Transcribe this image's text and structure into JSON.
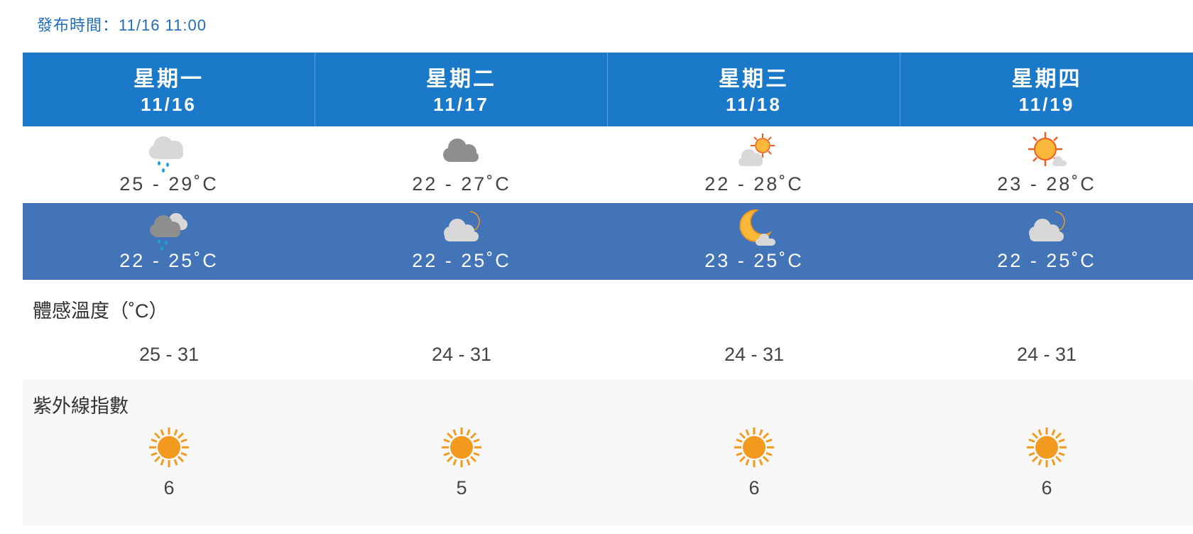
{
  "publish": {
    "label": "發布時間：",
    "time": "11/16 11:00"
  },
  "days": [
    {
      "name": "星期一",
      "date": "11/16",
      "day_icon": "cloud-rain-icon",
      "day_temp": "25 - 29˚C",
      "night_icon": "cloud-rain-dark-icon",
      "night_temp": "22 - 25˚C",
      "feel": "25 - 31",
      "uv": "6"
    },
    {
      "name": "星期二",
      "date": "11/17",
      "day_icon": "cloud-icon",
      "day_temp": "22 - 27˚C",
      "night_icon": "moon-cloud-icon",
      "night_temp": "22 - 25˚C",
      "feel": "24 - 31",
      "uv": "5"
    },
    {
      "name": "星期三",
      "date": "11/18",
      "day_icon": "sun-cloud-icon",
      "day_temp": "22 - 28˚C",
      "night_icon": "moon-icon",
      "night_temp": "23 - 25˚C",
      "feel": "24 - 31",
      "uv": "6"
    },
    {
      "name": "星期四",
      "date": "11/19",
      "day_icon": "sun-icon",
      "day_temp": "23 - 28˚C",
      "night_icon": "moon-cloud-icon",
      "night_temp": "22 - 25˚C",
      "feel": "24 - 31",
      "uv": "6"
    }
  ],
  "labels": {
    "feel": "體感溫度（˚C）",
    "uv": "紫外線指數"
  },
  "uv_icon": "uv-sun-icon",
  "colors": {
    "header": "#1b79c9",
    "night": "#4474b8",
    "publish": "#1f6db8",
    "uv_sun": "#f29a1e"
  }
}
